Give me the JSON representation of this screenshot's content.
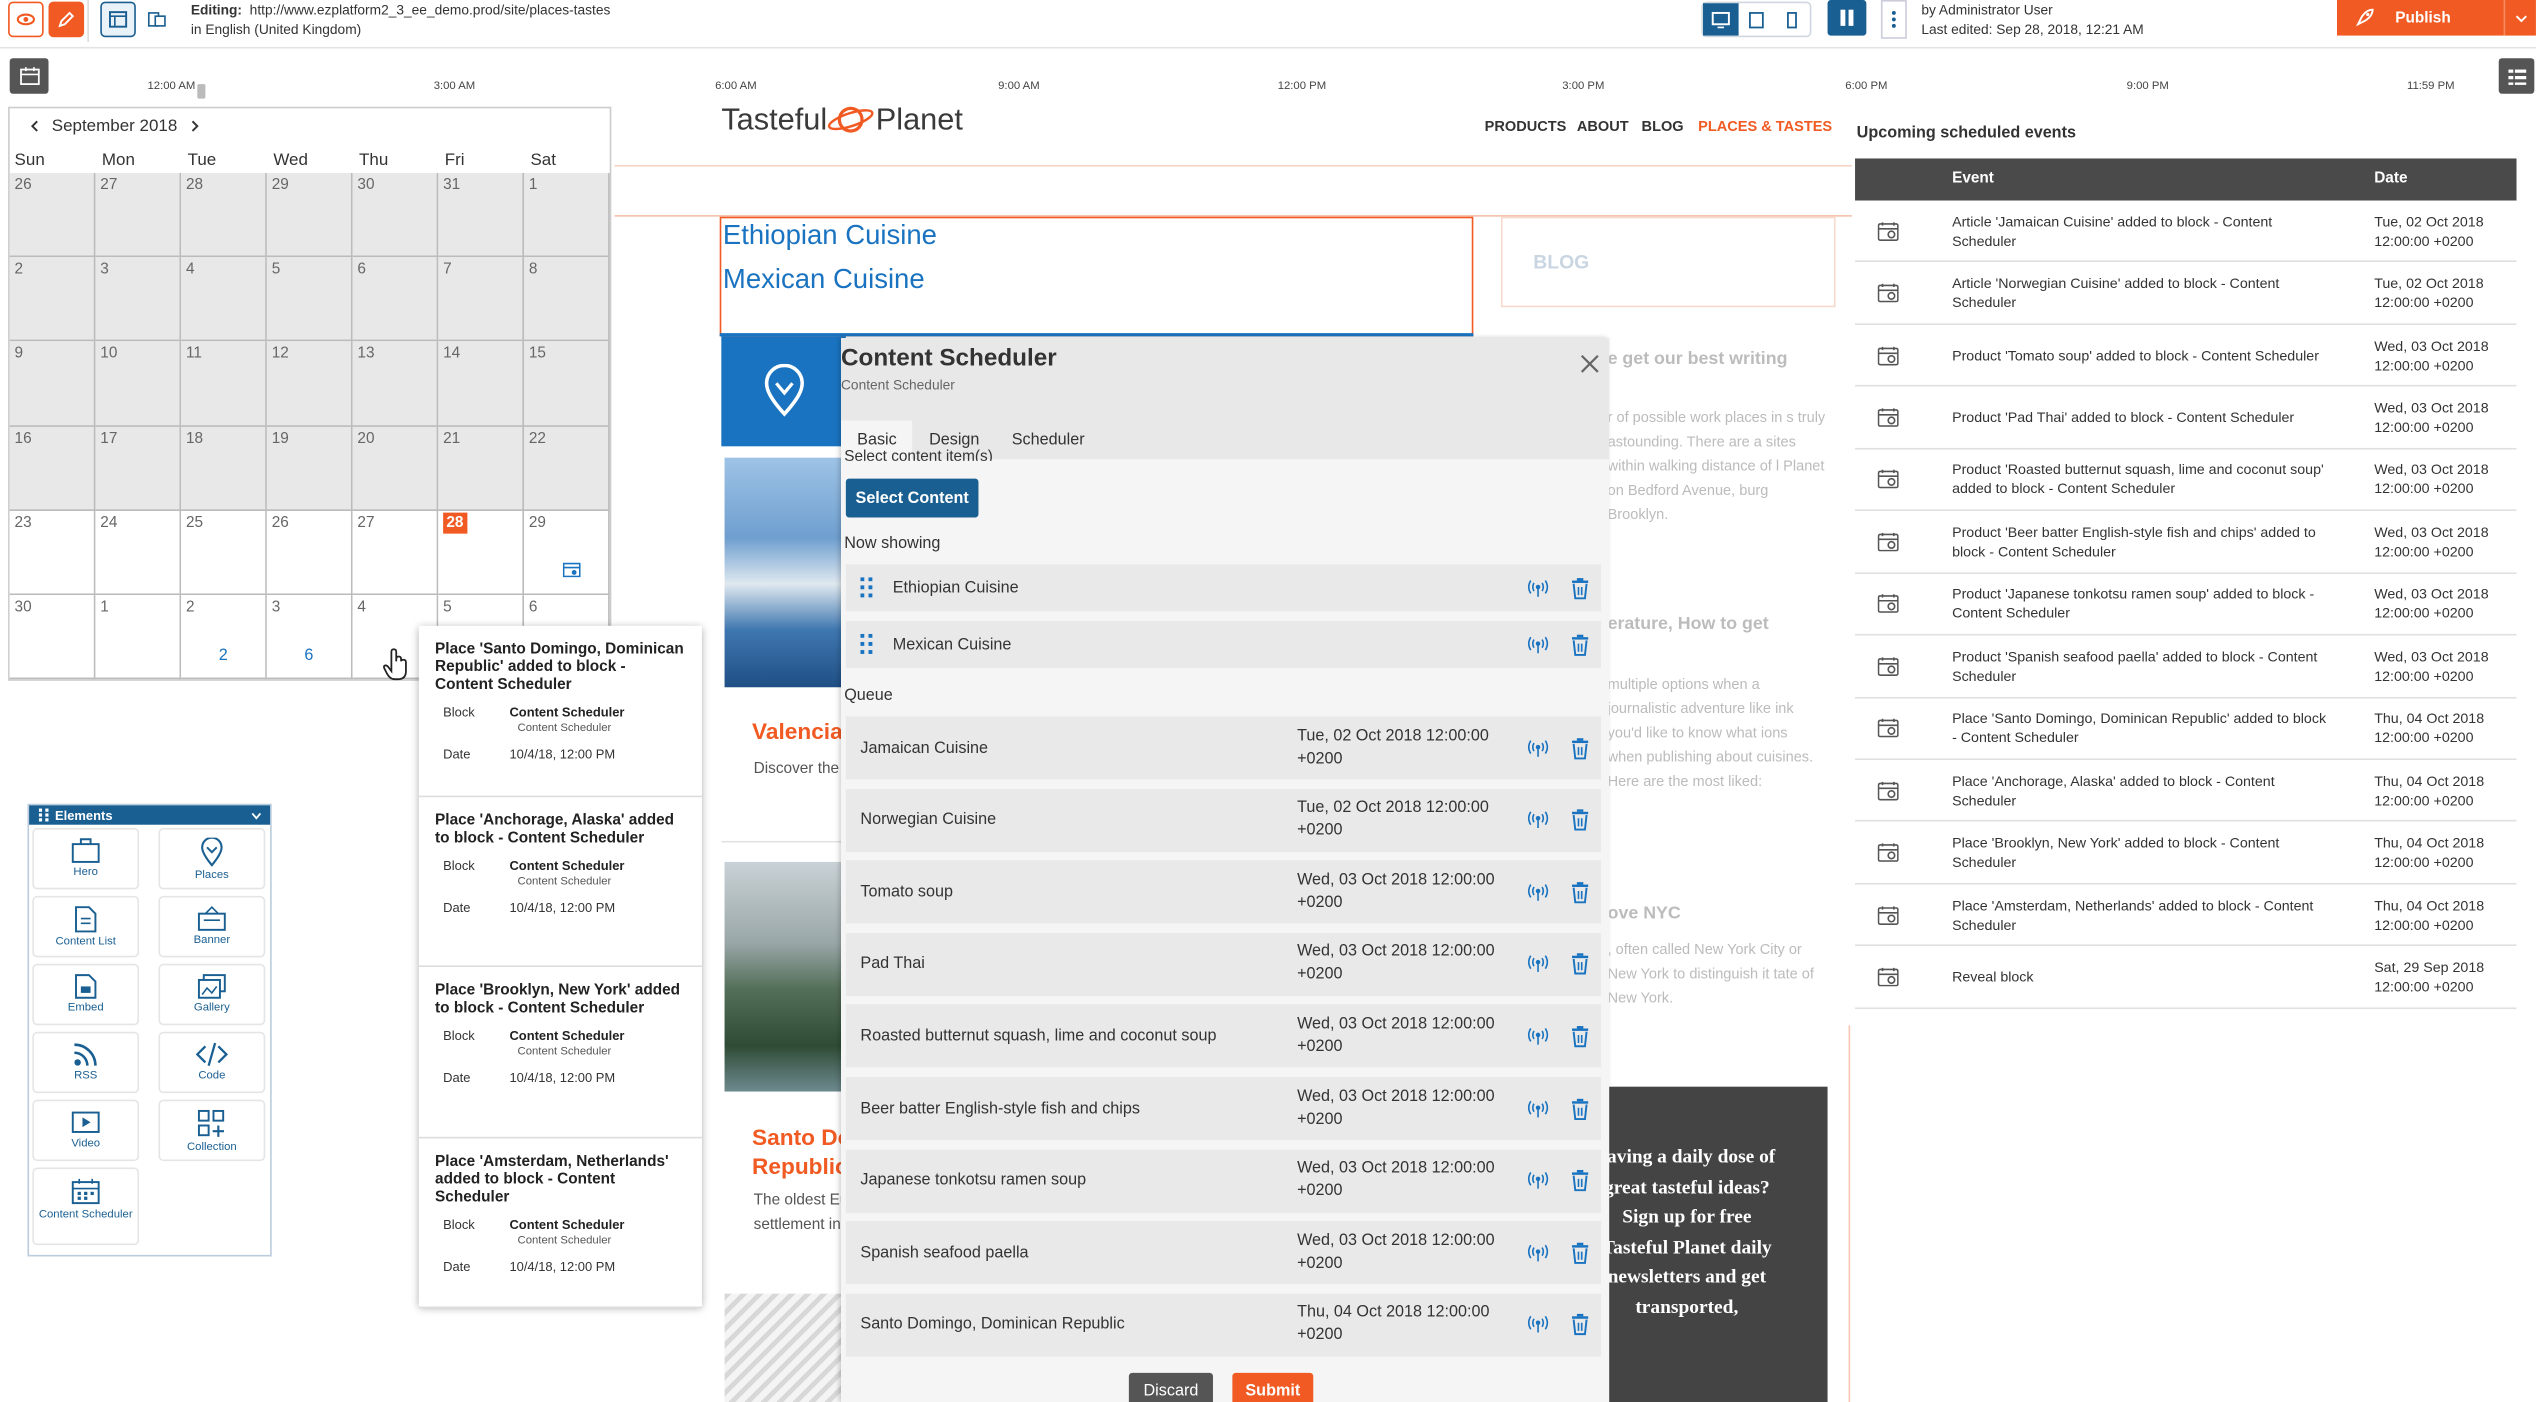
{
  "toolbar": {
    "editing_label": "Editing:",
    "url": "http://www.ezplatform2_3_ee_demo.prod/site/places-tastes",
    "language": "in English (United Kingdom)",
    "author": "by Administrator User",
    "last_edited": "Last edited: Sep 28, 2018, 12:21 AM",
    "publish_label": "Publish",
    "accent_color": "#f15a22"
  },
  "timeline": {
    "labels": [
      "12:00 AM",
      "3:00 AM",
      "6:00 AM",
      "9:00 AM",
      "12:00 PM",
      "3:00 PM",
      "6:00 PM",
      "9:00 PM",
      "11:59 PM"
    ]
  },
  "calendar": {
    "month": "September 2018",
    "weekdays": [
      "Sun",
      "Mon",
      "Tue",
      "Wed",
      "Thu",
      "Fri",
      "Sat"
    ],
    "weeks": [
      [
        "26",
        "27",
        "28",
        "29",
        "30",
        "31",
        "1"
      ],
      [
        "2",
        "3",
        "4",
        "5",
        "6",
        "7",
        "8"
      ],
      [
        "9",
        "10",
        "11",
        "12",
        "13",
        "14",
        "15"
      ],
      [
        "16",
        "17",
        "18",
        "19",
        "20",
        "21",
        "22"
      ],
      [
        "23",
        "24",
        "25",
        "26",
        "27",
        "28",
        "29"
      ],
      [
        "30",
        "1",
        "2",
        "3",
        "4",
        "5",
        "6"
      ]
    ],
    "today": "28",
    "counts": {
      "tue": "2",
      "wed": "6"
    }
  },
  "popup_events": [
    {
      "title": "Place 'Santo Domingo, Dominican Republic' added to block - Content Scheduler",
      "block_label": "Block",
      "block": "Content Scheduler",
      "block_sub": "Content Scheduler",
      "date_label": "Date",
      "date": "10/4/18, 12:00 PM"
    },
    {
      "title": "Place 'Anchorage, Alaska' added to block - Content Scheduler",
      "block_label": "Block",
      "block": "Content Scheduler",
      "block_sub": "Content Scheduler",
      "date_label": "Date",
      "date": "10/4/18, 12:00 PM"
    },
    {
      "title": "Place 'Brooklyn, New York' added to block - Content Scheduler",
      "block_label": "Block",
      "block": "Content Scheduler",
      "block_sub": "Content Scheduler",
      "date_label": "Date",
      "date": "10/4/18, 12:00 PM"
    },
    {
      "title": "Place 'Amsterdam, Netherlands' added to block - Content Scheduler",
      "block_label": "Block",
      "block": "Content Scheduler",
      "block_sub": "Content Scheduler",
      "date_label": "Date",
      "date": "10/4/18, 12:00 PM"
    }
  ],
  "elements_panel": {
    "title": "Elements",
    "items": [
      "Hero",
      "Places",
      "Content List",
      "Banner",
      "Embed",
      "Gallery",
      "RSS",
      "Code",
      "Video",
      "Collection",
      "Content Scheduler"
    ]
  },
  "site": {
    "logo_a": "Tasteful",
    "logo_b": "Planet",
    "nav": [
      "PRODUCTS",
      "ABOUT",
      "BLOG",
      "PLACES & TASTES"
    ],
    "block_items": [
      "Ethiopian Cuisine",
      "Mexican Cuisine"
    ],
    "card1_title": "Valencia,",
    "card1_text": "Discover the t",
    "card2_title": "Santo Do",
    "card2_title_b": "Republic",
    "card2_text": "The oldest Eu",
    "card2_text_b": "settlement in",
    "blog_heading": "BLOG",
    "blog1_title": "e get our best writing",
    "blog1_text": "r of possible work places in s truly astounding. There are a sites within walking distance of l Planet on Bedford Avenue, burg Brooklyn.",
    "blog2_title": "erature, How to get",
    "blog2_text": "multiple options when a journalistic adventure like ink you'd like to know what ions when publishing about cuisines. Here are the most liked:",
    "blog3_title": "ove NYC",
    "blog3_text": ", often called New York City or New York to distinguish it tate of New York.",
    "promo_text": "raving a daily dose of great tasteful ideas? Sign up for free Tasteful Planet daily newsletters and get transported,"
  },
  "modal": {
    "title": "Content Scheduler",
    "subtitle": "Content Scheduler",
    "tabs": [
      "Basic",
      "Design",
      "Scheduler"
    ],
    "select_label": "Select content item(s)",
    "select_button": "Select Content",
    "now_showing_label": "Now showing",
    "now_showing": [
      "Ethiopian Cuisine",
      "Mexican Cuisine"
    ],
    "queue_label": "Queue",
    "queue": [
      {
        "name": "Jamaican Cuisine",
        "date": "Tue, 02 Oct 2018 12:00:00",
        "tz": "+0200"
      },
      {
        "name": "Norwegian Cuisine",
        "date": "Tue, 02 Oct 2018 12:00:00",
        "tz": "+0200"
      },
      {
        "name": "Tomato soup",
        "date": "Wed, 03 Oct 2018 12:00:00",
        "tz": "+0200"
      },
      {
        "name": "Pad Thai",
        "date": "Wed, 03 Oct 2018 12:00:00",
        "tz": "+0200"
      },
      {
        "name": "Roasted butternut squash, lime and coconut soup",
        "date": "Wed, 03 Oct 2018 12:00:00",
        "tz": "+0200"
      },
      {
        "name": "Beer batter English-style fish and chips",
        "date": "Wed, 03 Oct 2018 12:00:00",
        "tz": "+0200"
      },
      {
        "name": "Japanese tonkotsu ramen soup",
        "date": "Wed, 03 Oct 2018 12:00:00",
        "tz": "+0200"
      },
      {
        "name": "Spanish seafood paella",
        "date": "Wed, 03 Oct 2018 12:00:00",
        "tz": "+0200"
      },
      {
        "name": "Santo Domingo, Dominican Republic",
        "date": "Thu, 04 Oct 2018 12:00:00",
        "tz": "+0200"
      }
    ],
    "discard": "Discard",
    "submit": "Submit"
  },
  "events_panel": {
    "title": "Upcoming scheduled events",
    "col_event": "Event",
    "col_date": "Date",
    "rows": [
      {
        "event": "Article 'Jamaican Cuisine' added to block - Content Scheduler",
        "date": "Tue, 02 Oct 2018",
        "time": "12:00:00 +0200"
      },
      {
        "event": "Article 'Norwegian Cuisine' added to block - Content Scheduler",
        "date": "Tue, 02 Oct 2018",
        "time": "12:00:00 +0200"
      },
      {
        "event": "Product 'Tomato soup' added to block - Content Scheduler",
        "date": "Wed, 03 Oct 2018",
        "time": "12:00:00 +0200"
      },
      {
        "event": "Product 'Pad Thai' added to block - Content Scheduler",
        "date": "Wed, 03 Oct 2018",
        "time": "12:00:00 +0200"
      },
      {
        "event": "Product 'Roasted butternut squash, lime and coconut soup' added to block - Content Scheduler",
        "date": "Wed, 03 Oct 2018",
        "time": "12:00:00 +0200"
      },
      {
        "event": "Product 'Beer batter English-style fish and chips' added to block - Content Scheduler",
        "date": "Wed, 03 Oct 2018",
        "time": "12:00:00 +0200"
      },
      {
        "event": "Product 'Japanese tonkotsu ramen soup' added to block - Content Scheduler",
        "date": "Wed, 03 Oct 2018",
        "time": "12:00:00 +0200"
      },
      {
        "event": "Product 'Spanish seafood paella' added to block - Content Scheduler",
        "date": "Wed, 03 Oct 2018",
        "time": "12:00:00 +0200"
      },
      {
        "event": "Place 'Santo Domingo, Dominican Republic' added to block - Content Scheduler",
        "date": "Thu, 04 Oct 2018",
        "time": "12:00:00 +0200"
      },
      {
        "event": "Place 'Anchorage, Alaska' added to block - Content Scheduler",
        "date": "Thu, 04 Oct 2018",
        "time": "12:00:00 +0200"
      },
      {
        "event": "Place 'Brooklyn, New York' added to block - Content Scheduler",
        "date": "Thu, 04 Oct 2018",
        "time": "12:00:00 +0200"
      },
      {
        "event": "Place 'Amsterdam, Netherlands' added to block - Content Scheduler",
        "date": "Thu, 04 Oct 2018",
        "time": "12:00:00 +0200"
      },
      {
        "event": "Reveal block",
        "date": "Sat, 29 Sep 2018",
        "time": "12:00:00 +0200"
      }
    ]
  }
}
